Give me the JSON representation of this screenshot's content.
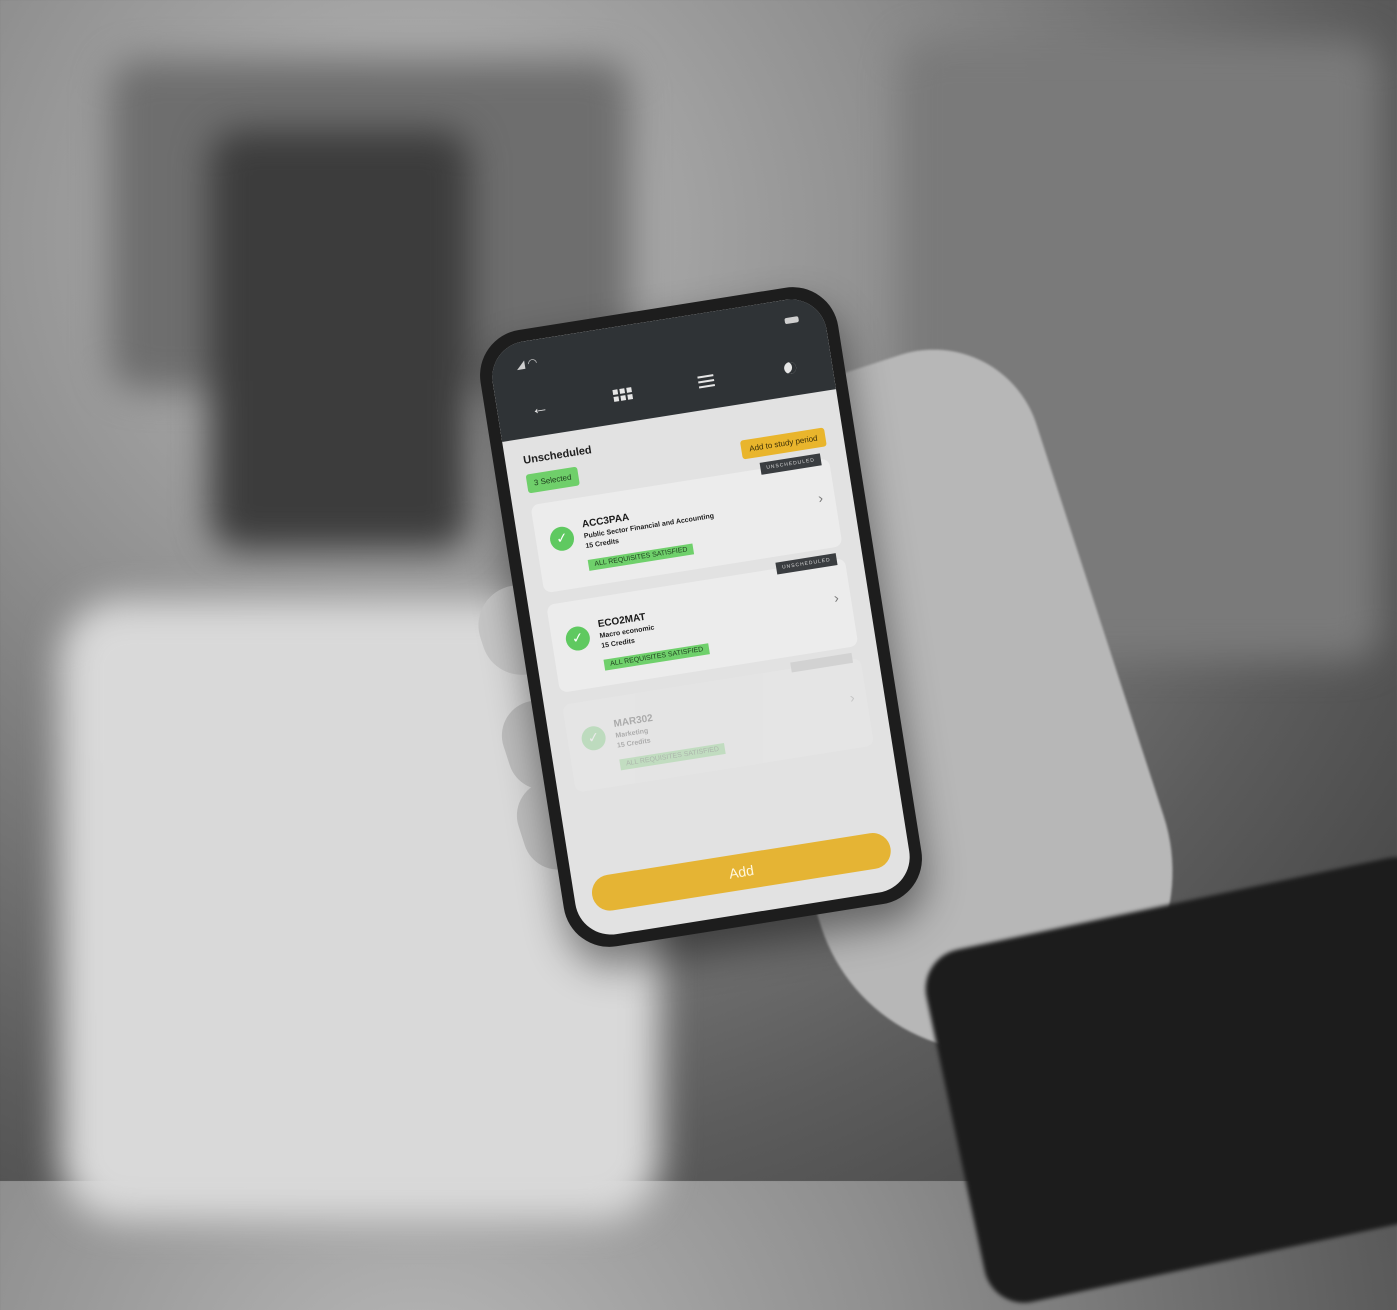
{
  "app": {
    "nav": {
      "back_icon": "back-arrow-icon",
      "grid_icon": "grid-icon",
      "list_icon": "list-icon",
      "theme_icon": "moon-icon"
    },
    "section_title": "Unscheduled",
    "selected_count": "3 Selected",
    "add_to_period_label": "Add to study period",
    "courses": [
      {
        "tag": "UNSCHEDULED",
        "code": "ACC3PAA",
        "name": "Public Sector Financial and Accounting",
        "credits": "15 Credits",
        "status": "ALL REQUISITES SATISFIED"
      },
      {
        "tag": "UNSCHEDULED",
        "code": "ECO2MAT",
        "name": "Macro economic",
        "credits": "15 Credits",
        "status": "ALL REQUISITES SATISFIED"
      },
      {
        "tag": "",
        "code": "MAR302",
        "name": "Marketing",
        "credits": "15 Credits",
        "status": "ALL REQUISITES SATISFIED"
      }
    ],
    "add_button_label": "Add",
    "colors": {
      "accent": "#e5b434",
      "success": "#5fc960",
      "header": "#2f3336"
    }
  }
}
